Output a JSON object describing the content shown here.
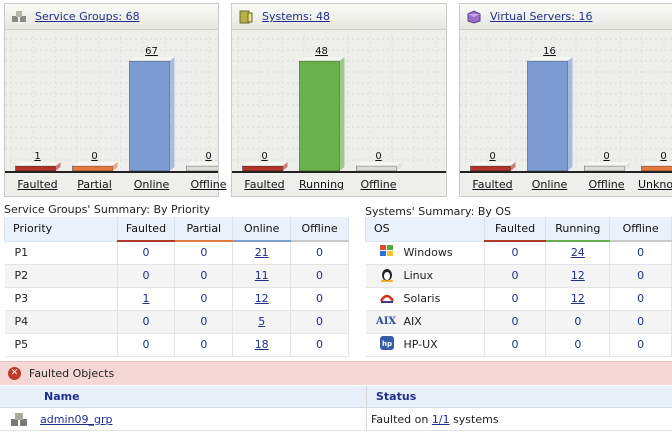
{
  "panels": [
    {
      "title": "Service Groups: 68",
      "icon": "service-groups-icon",
      "chart_data": {
        "type": "bar",
        "categories": [
          "Faulted",
          "Partial",
          "Online",
          "Offline"
        ],
        "values": [
          1,
          0,
          67,
          0
        ],
        "colors": [
          "#b0342a",
          "#e07a3e",
          "#7d9bd3",
          "#dcdcd6"
        ],
        "ylim": [
          0,
          67
        ]
      }
    },
    {
      "title": "Systems: 48",
      "icon": "systems-icon",
      "chart_data": {
        "type": "bar",
        "categories": [
          "Faulted",
          "Running",
          "Offline"
        ],
        "values": [
          0,
          48,
          0
        ],
        "colors": [
          "#b0342a",
          "#6ab04c",
          "#dcdcd6"
        ],
        "ylim": [
          0,
          48
        ]
      }
    },
    {
      "title": "Virtual Servers: 16",
      "icon": "virtual-servers-icon",
      "chart_data": {
        "type": "bar",
        "categories": [
          "Faulted",
          "Online",
          "Offline",
          "Unknown"
        ],
        "values": [
          0,
          16,
          0,
          0
        ],
        "colors": [
          "#b0342a",
          "#7d9bd3",
          "#dcdcd6",
          "#e07a3e"
        ],
        "ylim": [
          0,
          16
        ]
      }
    }
  ],
  "sg_summary": {
    "title": "Service Groups' Summary: By Priority",
    "headers": [
      "Priority",
      "Faulted",
      "Partial",
      "Online",
      "Offline"
    ],
    "rows": [
      [
        "P1",
        "0",
        "0",
        "21",
        "0"
      ],
      [
        "P2",
        "0",
        "0",
        "11",
        "0"
      ],
      [
        "P3",
        "1",
        "0",
        "12",
        "0"
      ],
      [
        "P4",
        "0",
        "0",
        "5",
        "0"
      ],
      [
        "P5",
        "0",
        "0",
        "18",
        "0"
      ]
    ]
  },
  "os_summary": {
    "title": "Systems' Summary: By OS",
    "headers": [
      "OS",
      "Faulted",
      "Running",
      "Offline"
    ],
    "rows": [
      {
        "os": "Windows",
        "icon": "windows-icon",
        "values": [
          "0",
          "24",
          "0"
        ]
      },
      {
        "os": "Linux",
        "icon": "linux-icon",
        "values": [
          "0",
          "12",
          "0"
        ]
      },
      {
        "os": "Solaris",
        "icon": "solaris-icon",
        "values": [
          "0",
          "12",
          "0"
        ]
      },
      {
        "os": "AIX",
        "icon": "aix-icon",
        "values": [
          "0",
          "0",
          "0"
        ]
      },
      {
        "os": "HP-UX",
        "icon": "hpux-icon",
        "values": [
          "0",
          "0",
          "0"
        ]
      }
    ]
  },
  "faulted_objects": {
    "title": "Faulted Objects",
    "headers": {
      "name": "Name",
      "status": "Status"
    },
    "row": {
      "name": "admin09_grp",
      "status_prefix": "Faulted on",
      "status_link": "1/1",
      "status_suffix": "systems"
    }
  }
}
